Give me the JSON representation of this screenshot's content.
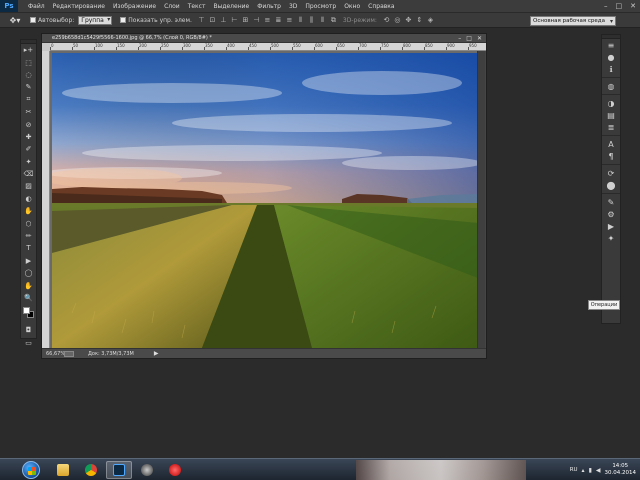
{
  "menubar": {
    "logo": "Ps",
    "items": [
      "Файл",
      "Редактирование",
      "Изображение",
      "Слои",
      "Текст",
      "Выделение",
      "Фильтр",
      "3D",
      "Просмотр",
      "Окно",
      "Справка"
    ],
    "window_controls": [
      "–",
      "□",
      "✕"
    ]
  },
  "options": {
    "tool_icon": "move-tool-icon",
    "autoselect_label": "Автовыбор:",
    "autoselect_value": "Группа",
    "show_controls_label": "Показать упр. элем.",
    "mode3d_label": "3D-режим:",
    "workspace": "Основная рабочая среда"
  },
  "document": {
    "tab_title": "e259b658d1c5429f5566-1600.jpg @ 66,7% (Слой 0, RGB/8#) *",
    "controls": [
      "–",
      "□",
      "✕"
    ],
    "ruler_labels": [
      "0",
      "50",
      "100",
      "150",
      "200",
      "250",
      "300",
      "350",
      "400",
      "450",
      "500",
      "550",
      "600",
      "650",
      "700",
      "750",
      "800",
      "850",
      "900",
      "950"
    ],
    "zoom": "66,67%",
    "doc_info": "Док: 3,73M/3,73M",
    "status_arrow": "▶"
  },
  "tools": [
    "▸+",
    "⬚",
    "◌",
    "✎",
    "⌗",
    "✂",
    "⊘",
    "✚",
    "✐",
    "✦",
    "⌫",
    "▨",
    "◐",
    "✋",
    "⬡",
    "✏",
    "T",
    "▶",
    "◯",
    "✋",
    "🔍"
  ],
  "dock_icons": [
    "≡",
    "●",
    "ℹ",
    "◍",
    "◑",
    "▤",
    "≣",
    "A",
    "¶",
    "⟳",
    "⬤",
    "✎",
    "⚙",
    "▶",
    "✦"
  ],
  "tooltip": "Операции",
  "taskbar": {
    "clock_time": "14:05",
    "clock_date": "30.04.2014",
    "lang": "RU",
    "apps": [
      "explorer",
      "chrome",
      "photoshop",
      "steam",
      "record"
    ]
  }
}
